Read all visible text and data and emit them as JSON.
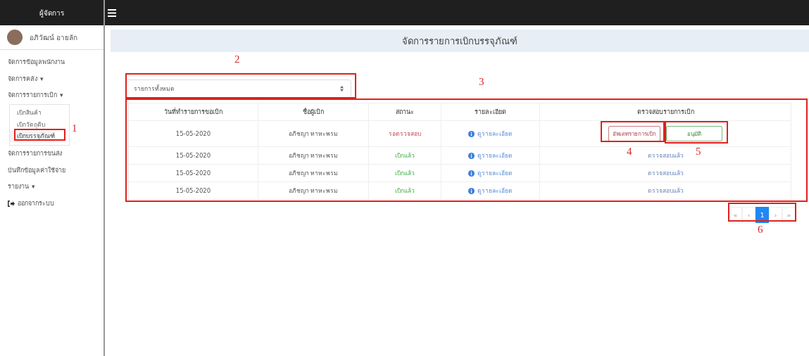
{
  "sidebar": {
    "title": "ผู้จัดการ",
    "user": "อภิวัฒน์ อายลัก",
    "items": [
      {
        "label": "จัดการข้อมูลพนักงาน",
        "kind": "link"
      },
      {
        "label": "จัดการคลัง",
        "kind": "dropdown",
        "caret": "▾"
      },
      {
        "label": "จัดการรายการเบิก",
        "kind": "dropdown",
        "caret": "▾",
        "children": [
          {
            "label": "เบิกสินค้า",
            "selected": false
          },
          {
            "label": "เบิกวัตถุดิบ",
            "selected": false
          },
          {
            "label": "เบิกบรรจุภัณฑ์",
            "selected": true
          }
        ]
      },
      {
        "label": "จัดการรายการขนส่ง",
        "kind": "link"
      },
      {
        "label": "บันทึกข้อมูลค่าใช้จ่าย",
        "kind": "link"
      },
      {
        "label": "รายงาน",
        "kind": "dropdown",
        "caret": "▾"
      },
      {
        "label": "ออกจากระบบ",
        "kind": "logout"
      }
    ]
  },
  "page_title": "จัดการรายการเบิกบรรจุภัณฑ์",
  "filter": {
    "value": "รายการทั้งหมด"
  },
  "table": {
    "columns": [
      "วันที่ทำรายการขอเบิก",
      "ชื่อผู้เบิก",
      "สถานะ",
      "รายละเอียด",
      "ตรวจสอบรายการเบิก"
    ],
    "rows": [
      {
        "date": "15-05-2020",
        "name": "อภิชญา ทาหะพรม",
        "status": "รอตรวจสอบ",
        "approved": false,
        "detail": "ดูรายละเอียด",
        "check": {
          "kind": "buttons",
          "update": "อัพเดทรายการเบิก",
          "approve": "อนุมัติ"
        }
      },
      {
        "date": "15-05-2020",
        "name": "อภิชญา ทาหะพรม",
        "status": "เบิกแล้ว",
        "approved": true,
        "detail": "ดูรายละเอียด",
        "check": {
          "kind": "text",
          "text": "ตรวจสอบแล้ว"
        }
      },
      {
        "date": "15-05-2020",
        "name": "อภิชญา ทาหะพรม",
        "status": "เบิกแล้ว",
        "approved": true,
        "detail": "ดูรายละเอียด",
        "check": {
          "kind": "text",
          "text": "ตรวจสอบแล้ว"
        }
      },
      {
        "date": "15-05-2020",
        "name": "อภิชญา ทาหะพรม",
        "status": "เบิกแล้ว",
        "approved": true,
        "detail": "ดูรายละเอียด",
        "check": {
          "kind": "text",
          "text": "ตรวจสอบแล้ว"
        }
      }
    ]
  },
  "pagination": [
    {
      "label": "«",
      "selected": false
    },
    {
      "label": "‹",
      "selected": false
    },
    {
      "label": "1",
      "selected": true
    },
    {
      "label": "›",
      "selected": false
    },
    {
      "label": "»",
      "selected": false
    }
  ],
  "annotations": [
    {
      "label": "1"
    },
    {
      "label": "2"
    },
    {
      "label": "3"
    },
    {
      "label": "4"
    },
    {
      "label": "5"
    },
    {
      "label": "6"
    }
  ]
}
